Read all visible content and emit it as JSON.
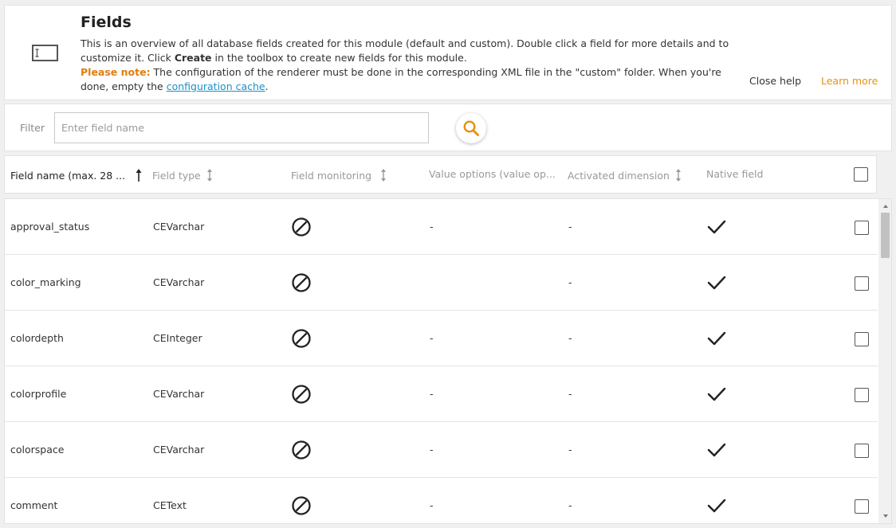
{
  "help": {
    "title": "Fields",
    "text_1": "This is an overview of all database fields created for this module (default and custom). Double click a field for more details and to customize it. Click ",
    "text_create": "Create",
    "text_2": " in the toolbox to create new fields for this module.",
    "note_label": "Please note:",
    "note_text": " The configuration of the renderer must be done in the corresponding XML file in the \"custom\" folder. When you're done, empty the ",
    "note_link": "configuration cache",
    "note_end": ".",
    "close_label": "Close help",
    "learn_more_label": "Learn more",
    "accent_color": "#e8900e",
    "link_color": "#1a8fc9"
  },
  "filter": {
    "label": "Filter",
    "placeholder": "Enter field name",
    "value": ""
  },
  "columns": {
    "field_name": "Field name (max. 28 ...",
    "field_type": "Field type",
    "field_monitoring": "Field monitoring",
    "value_options": "Value options (value op...",
    "activated_dimension": "Activated dimension",
    "native_field": "Native field"
  },
  "rows": [
    {
      "name": "approval_status",
      "type": "CEVarchar",
      "monitoring": "disabled",
      "value_options": "-",
      "dimension": "-",
      "native": true
    },
    {
      "name": "color_marking",
      "type": "CEVarchar",
      "monitoring": "disabled",
      "value_options": "",
      "dimension": "-",
      "native": true
    },
    {
      "name": "colordepth",
      "type": "CEInteger",
      "monitoring": "disabled",
      "value_options": "-",
      "dimension": "-",
      "native": true
    },
    {
      "name": "colorprofile",
      "type": "CEVarchar",
      "monitoring": "disabled",
      "value_options": "-",
      "dimension": "-",
      "native": true
    },
    {
      "name": "colorspace",
      "type": "CEVarchar",
      "monitoring": "disabled",
      "value_options": "-",
      "dimension": "-",
      "native": true
    },
    {
      "name": "comment",
      "type": "CEText",
      "monitoring": "disabled",
      "value_options": "-",
      "dimension": "-",
      "native": true
    }
  ]
}
